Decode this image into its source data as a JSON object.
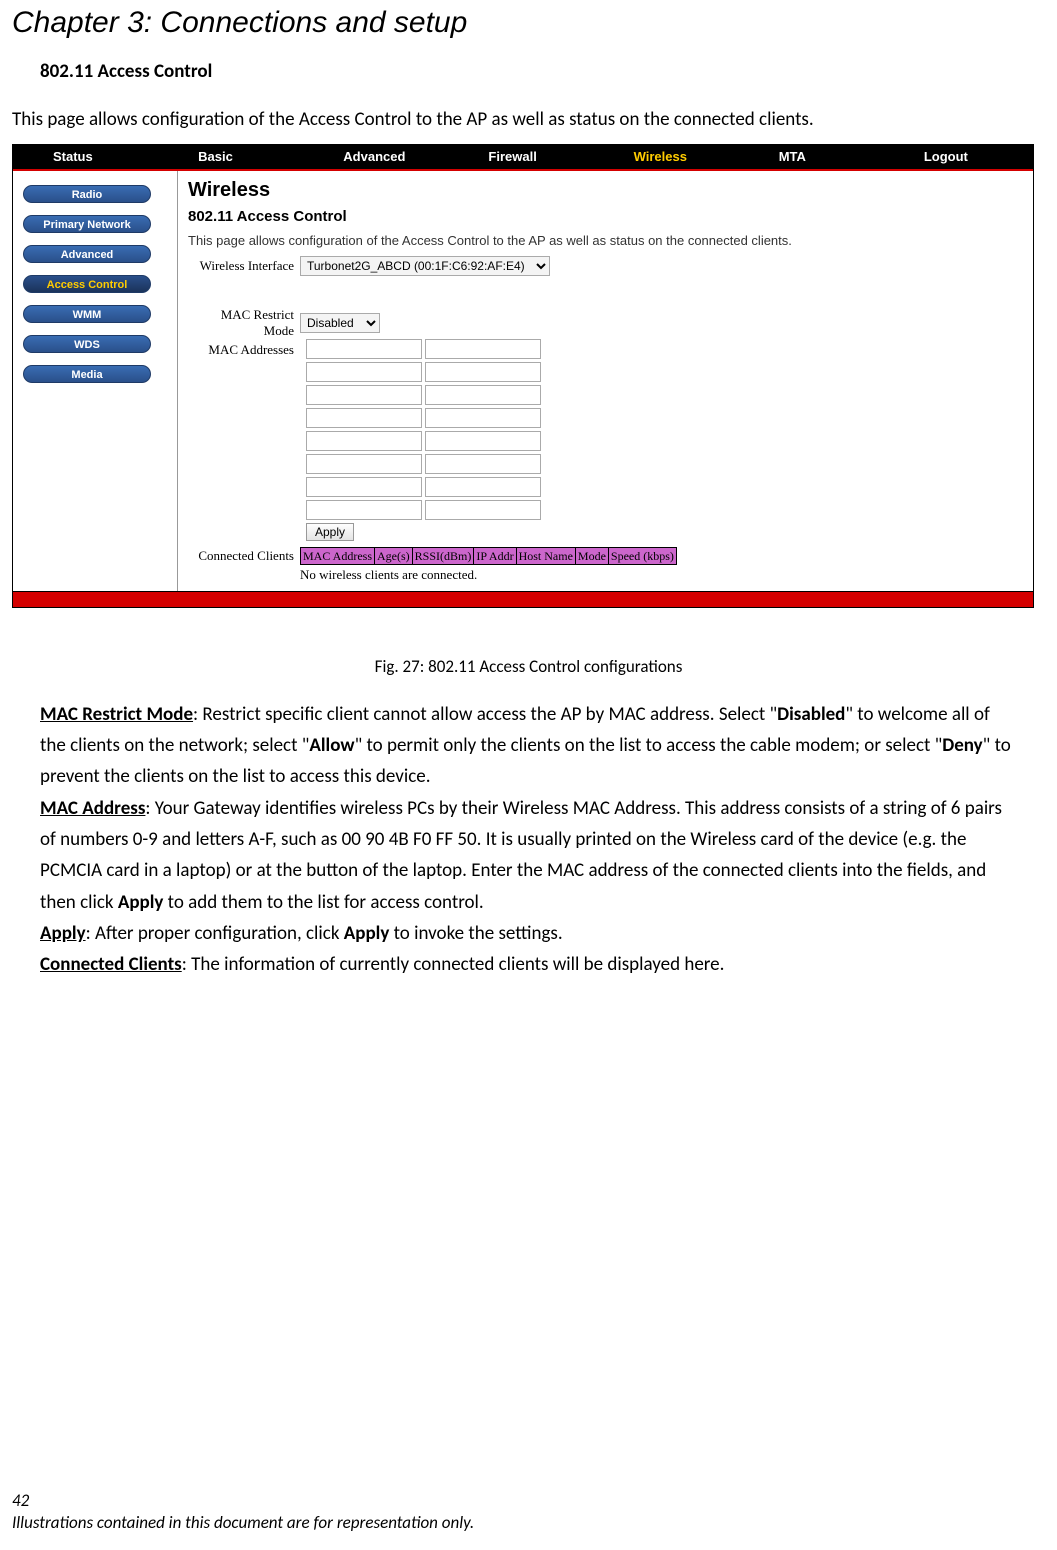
{
  "chapter_title": "Chapter 3: Connections and setup",
  "section_title": "802.11 Access Control",
  "intro": "This page allows configuration of the Access Control to the AP as well as status on the connected clients.",
  "admin": {
    "topnav": [
      "Status",
      "Basic",
      "Advanced",
      "Firewall",
      "Wireless",
      "MTA",
      "Logout"
    ],
    "topnav_active_index": 4,
    "sidebar": [
      "Radio",
      "Primary Network",
      "Advanced",
      "Access Control",
      "WMM",
      "WDS",
      "Media"
    ],
    "sidebar_active_index": 3,
    "heading": "Wireless",
    "subheading": "802.11 Access Control",
    "desc": "This page allows configuration of the Access Control to the AP as well as status on the connected clients.",
    "labels": {
      "wireless_interface": "Wireless Interface",
      "mac_restrict_mode": "MAC Restrict Mode",
      "mac_addresses": "MAC Addresses",
      "connected_clients": "Connected Clients"
    },
    "wireless_interface_value": "Turbonet2G_ABCD (00:1F:C6:92:AF:E4)",
    "mac_restrict_mode_value": "Disabled",
    "apply_label": "Apply",
    "clients_headers": [
      "MAC Address",
      "Age(s)",
      "RSSI(dBm)",
      "IP Addr",
      "Host Name",
      "Mode",
      "Speed (kbps)"
    ],
    "no_clients_msg": "No wireless clients are connected."
  },
  "caption": "Fig. 27: 802.11 Access Control configurations",
  "para": {
    "mac_restrict_label": "MAC Restrict Mode",
    "mac_restrict_text1": ": Restrict specific client cannot allow access the AP by MAC address. Select \"",
    "disabled": "Disabled",
    "mac_restrict_text2": "\" to welcome all of the clients on the network; select \"",
    "allow": "Allow",
    "mac_restrict_text3": "\" to permit only the clients on the list to access the cable modem; or select \"",
    "deny": "Deny",
    "mac_restrict_text4": "\" to prevent the clients on the list to access this device.",
    "mac_addr_label": "MAC Address",
    "mac_addr_text1": ": Your Gateway identifies wireless PCs by their Wireless MAC Address. This address consists of a string of 6 pairs of numbers 0-9 and letters A-F, such as 00 90 4B F0 FF 50. It is usually printed on the Wireless card of the device (e.g. the PCMCIA card in a laptop) or at the button of the laptop. Enter the MAC address of the connected clients into the fields, and then click ",
    "apply": "Apply",
    "mac_addr_text2": " to add them to the list for access control.",
    "apply_label": "Apply",
    "apply_text1": ": After proper configuration, click ",
    "apply_text2": " to invoke the settings.",
    "cc_label": "Connected Clients",
    "cc_text": ": The information of currently connected clients will be displayed here."
  },
  "footer": {
    "page_num": "42",
    "disclaimer": "Illustrations contained in this document are for representation only."
  }
}
